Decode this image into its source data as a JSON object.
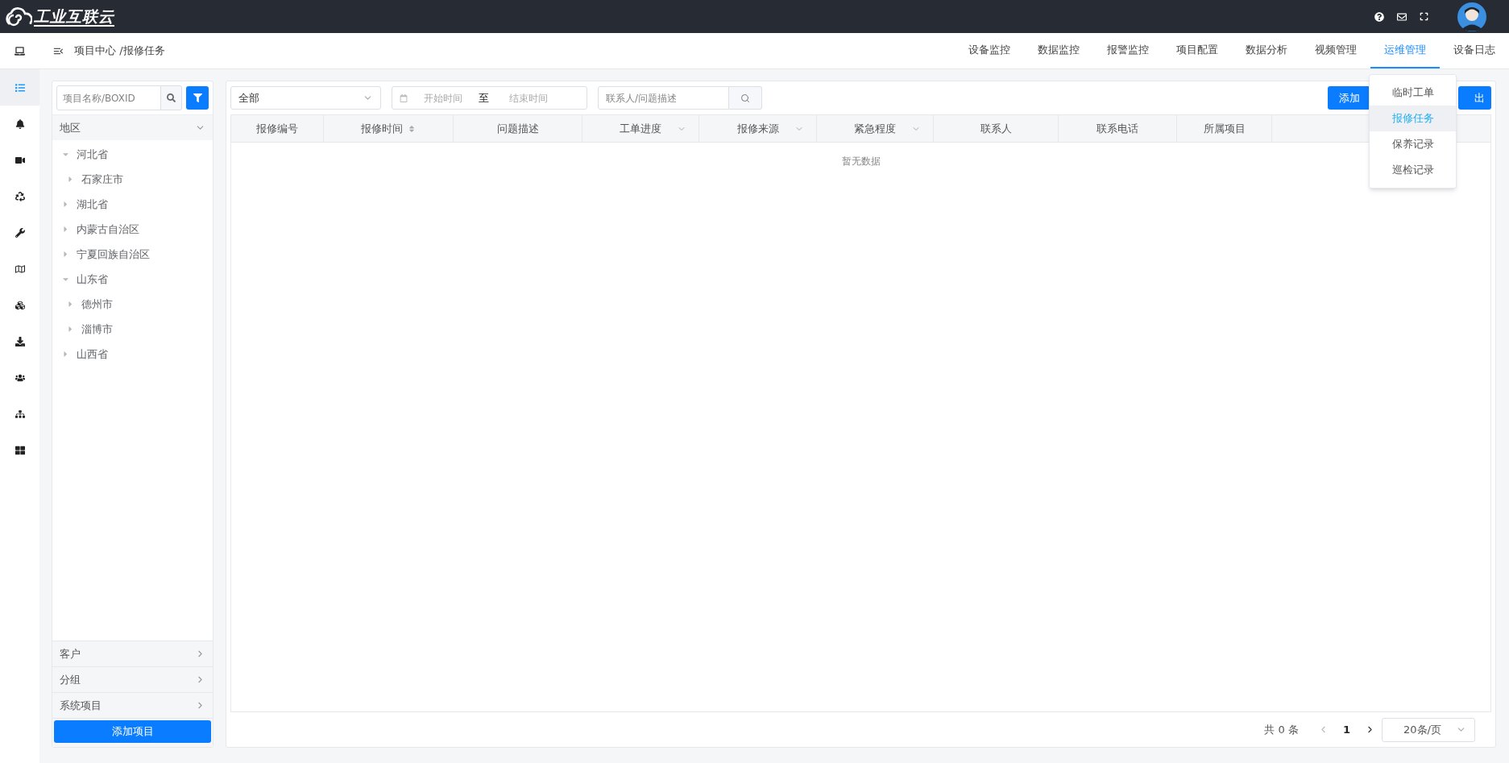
{
  "header": {
    "logo": "工业互联云"
  },
  "breadcrumb": "项目中心 /报修任务",
  "nav_tabs": [
    {
      "label": "设备监控",
      "selected": false
    },
    {
      "label": "数据监控",
      "selected": false
    },
    {
      "label": "报警监控",
      "selected": false
    },
    {
      "label": "项目配置",
      "selected": false
    },
    {
      "label": "数据分析",
      "selected": false
    },
    {
      "label": "视频管理",
      "selected": false
    },
    {
      "label": "运维管理",
      "selected": true
    },
    {
      "label": "设备日志",
      "selected": false
    }
  ],
  "nav_menu": [
    {
      "label": "临时工单",
      "selected": false
    },
    {
      "label": "报修任务",
      "selected": true
    },
    {
      "label": "保养记录",
      "selected": false
    },
    {
      "label": "巡检记录",
      "selected": false
    }
  ],
  "rail_items": [
    {
      "selected": true
    },
    {
      "selected": false
    },
    {
      "selected": false
    },
    {
      "selected": false
    },
    {
      "selected": false
    },
    {
      "selected": false
    },
    {
      "selected": false
    },
    {
      "selected": false
    },
    {
      "selected": false
    },
    {
      "selected": false
    },
    {
      "selected": false
    }
  ],
  "project_panel": {
    "search_placeholder": "项目名称/BOXID",
    "sections": [
      {
        "title": "地区",
        "expanded": true,
        "tree": [
          {
            "label": "河北省",
            "expanded": true,
            "children": [
              {
                "label": "石家庄市",
                "expanded": false
              }
            ]
          },
          {
            "label": "湖北省",
            "expanded": false
          },
          {
            "label": "内蒙古自治区",
            "expanded": false
          },
          {
            "label": "宁夏回族自治区",
            "expanded": false
          },
          {
            "label": "山东省",
            "expanded": true,
            "children": [
              {
                "label": "德州市",
                "expanded": false
              },
              {
                "label": "淄博市",
                "expanded": false
              }
            ]
          },
          {
            "label": "山西省",
            "expanded": false
          }
        ]
      },
      {
        "title": "客户",
        "expanded": false
      },
      {
        "title": "分组",
        "expanded": false
      },
      {
        "title": "系统项目",
        "expanded": false
      }
    ],
    "add_button": "添加项目"
  },
  "toolbar": {
    "status_select": "全部",
    "start_placeholder": "开始时间",
    "range_separator": "至",
    "end_placeholder": "结束时间",
    "search_placeholder": "联系人/问题描述",
    "add_button": "添加",
    "export_button": "出"
  },
  "table": {
    "columns": [
      {
        "label": "报修编号",
        "kind": "plain"
      },
      {
        "label": "报修时间",
        "kind": "sort"
      },
      {
        "label": "问题描述",
        "kind": "plain"
      },
      {
        "label": "工单进度",
        "kind": "filter"
      },
      {
        "label": "报修来源",
        "kind": "filter"
      },
      {
        "label": "紧急程度",
        "kind": "filter"
      },
      {
        "label": "联系人",
        "kind": "plain"
      },
      {
        "label": "联系电话",
        "kind": "plain"
      },
      {
        "label": "所属项目",
        "kind": "plain"
      }
    ],
    "empty_text": "暂无数据"
  },
  "pagination": {
    "total": "共 0 条",
    "page": "1",
    "page_size": "20条/页"
  }
}
